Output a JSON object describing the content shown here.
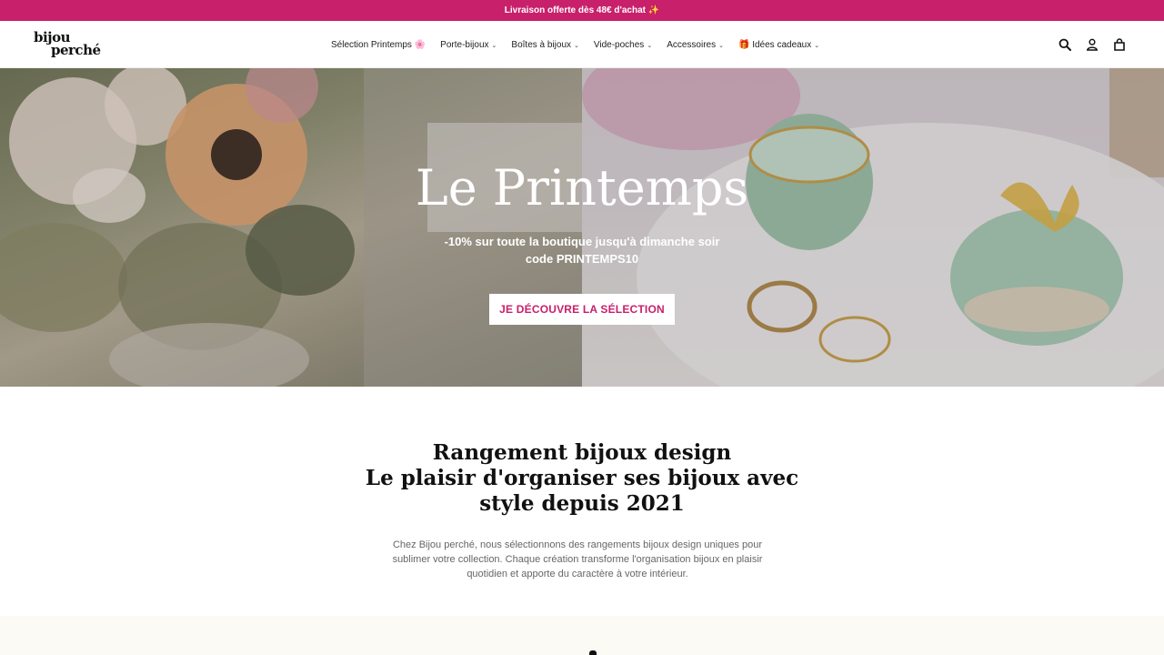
{
  "announcement": {
    "text": "Livraison offerte dès 48€ d'achat ✨"
  },
  "header": {
    "logo_line1": "bijou",
    "logo_line2": "perché",
    "nav": [
      {
        "label": "Sélection Printemps 🌸",
        "has_dropdown": false
      },
      {
        "label": "Porte-bijoux",
        "has_dropdown": true
      },
      {
        "label": "Boîtes à bijoux",
        "has_dropdown": true
      },
      {
        "label": "Vide-poches",
        "has_dropdown": true
      },
      {
        "label": "Accessoires",
        "has_dropdown": true
      },
      {
        "label": "🎁 Idées cadeaux",
        "has_dropdown": true
      }
    ],
    "icons": [
      "search-icon",
      "account-icon",
      "cart-icon"
    ]
  },
  "hero": {
    "title": "Le Printemps",
    "subtitle_line1": "-10% sur toute la boutique jusqu'à dimanche soir",
    "subtitle_line2": "code PRINTEMPS10",
    "button_label": "JE DÉCOUVRE LA SÉLECTION"
  },
  "intro": {
    "title_line1": "Rangement bijoux design",
    "title_line2": "Le plaisir d'organiser ses bijoux avec",
    "title_line3": "style depuis 2021",
    "text": "Chez Bijou perché, nous sélectionnons des rangements bijoux design uniques pour sublimer votre collection. Chaque création transforme l'organisation bijoux en plaisir quotidien et apporte du caractère à votre intérieur."
  },
  "colors": {
    "brand": "#c8206b",
    "section_bg": "#fbfaf4"
  }
}
